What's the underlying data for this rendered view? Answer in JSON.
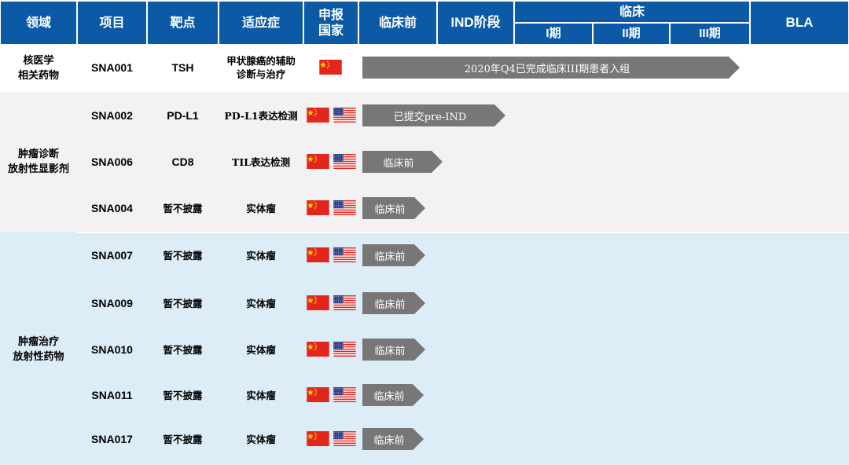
{
  "header": {
    "field": "领域",
    "project": "项目",
    "target": "靶点",
    "indication": "适应症",
    "country": "申报\n国家",
    "preclinical": "临床前",
    "ind": "IND阶段",
    "clinical": "临床",
    "phase1": "I期",
    "phase2": "II期",
    "phase3": "III期",
    "bla": "BLA"
  },
  "groups": [
    {
      "name": "核医学\n相关药物",
      "color": "#ffffff"
    },
    {
      "name": "肿瘤诊断\n放射性显影剂",
      "color": "#f2f2f2"
    },
    {
      "name": "肿瘤治疗\n放射性药物",
      "color": "#dcedf8"
    }
  ],
  "rows": [
    {
      "project": "SNA001",
      "target": "TSH",
      "indication": "甲状腺癌的辅助\n诊断与治疗",
      "countries": [
        "cn"
      ],
      "stage_label": "2020年Q4已完成临床III期患者入组"
    },
    {
      "project": "SNA002",
      "target": "PD-L1",
      "indication": "PD-L1表达检测",
      "countries": [
        "cn",
        "us"
      ],
      "stage_label": "已提交pre-IND"
    },
    {
      "project": "SNA006",
      "target": "CD8",
      "indication": "TIL表达检测",
      "countries": [
        "cn",
        "us"
      ],
      "stage_label": "临床前"
    },
    {
      "project": "SNA004",
      "target": "暂不披露",
      "indication": "实体瘤",
      "countries": [
        "cn",
        "us"
      ],
      "stage_label": "临床前"
    },
    {
      "project": "SNA007",
      "target": "暂不披露",
      "indication": "实体瘤",
      "countries": [
        "cn",
        "us"
      ],
      "stage_label": "临床前"
    },
    {
      "project": "SNA009",
      "target": "暂不披露",
      "indication": "实体瘤",
      "countries": [
        "cn",
        "us"
      ],
      "stage_label": "临床前"
    },
    {
      "project": "SNA010",
      "target": "暂不披露",
      "indication": "实体瘤",
      "countries": [
        "cn",
        "us"
      ],
      "stage_label": "临床前"
    },
    {
      "project": "SNA011",
      "target": "暂不披露",
      "indication": "实体瘤",
      "countries": [
        "cn",
        "us"
      ],
      "stage_label": "临床前"
    },
    {
      "project": "SNA017",
      "target": "暂不披露",
      "indication": "实体瘤",
      "countries": [
        "cn",
        "us"
      ],
      "stage_label": "临床前"
    }
  ],
  "colors": {
    "header": "#0c5aa6",
    "arrow": "#777777",
    "flag_red": "#e3261c",
    "flag_blue": "#2b3a8c"
  }
}
